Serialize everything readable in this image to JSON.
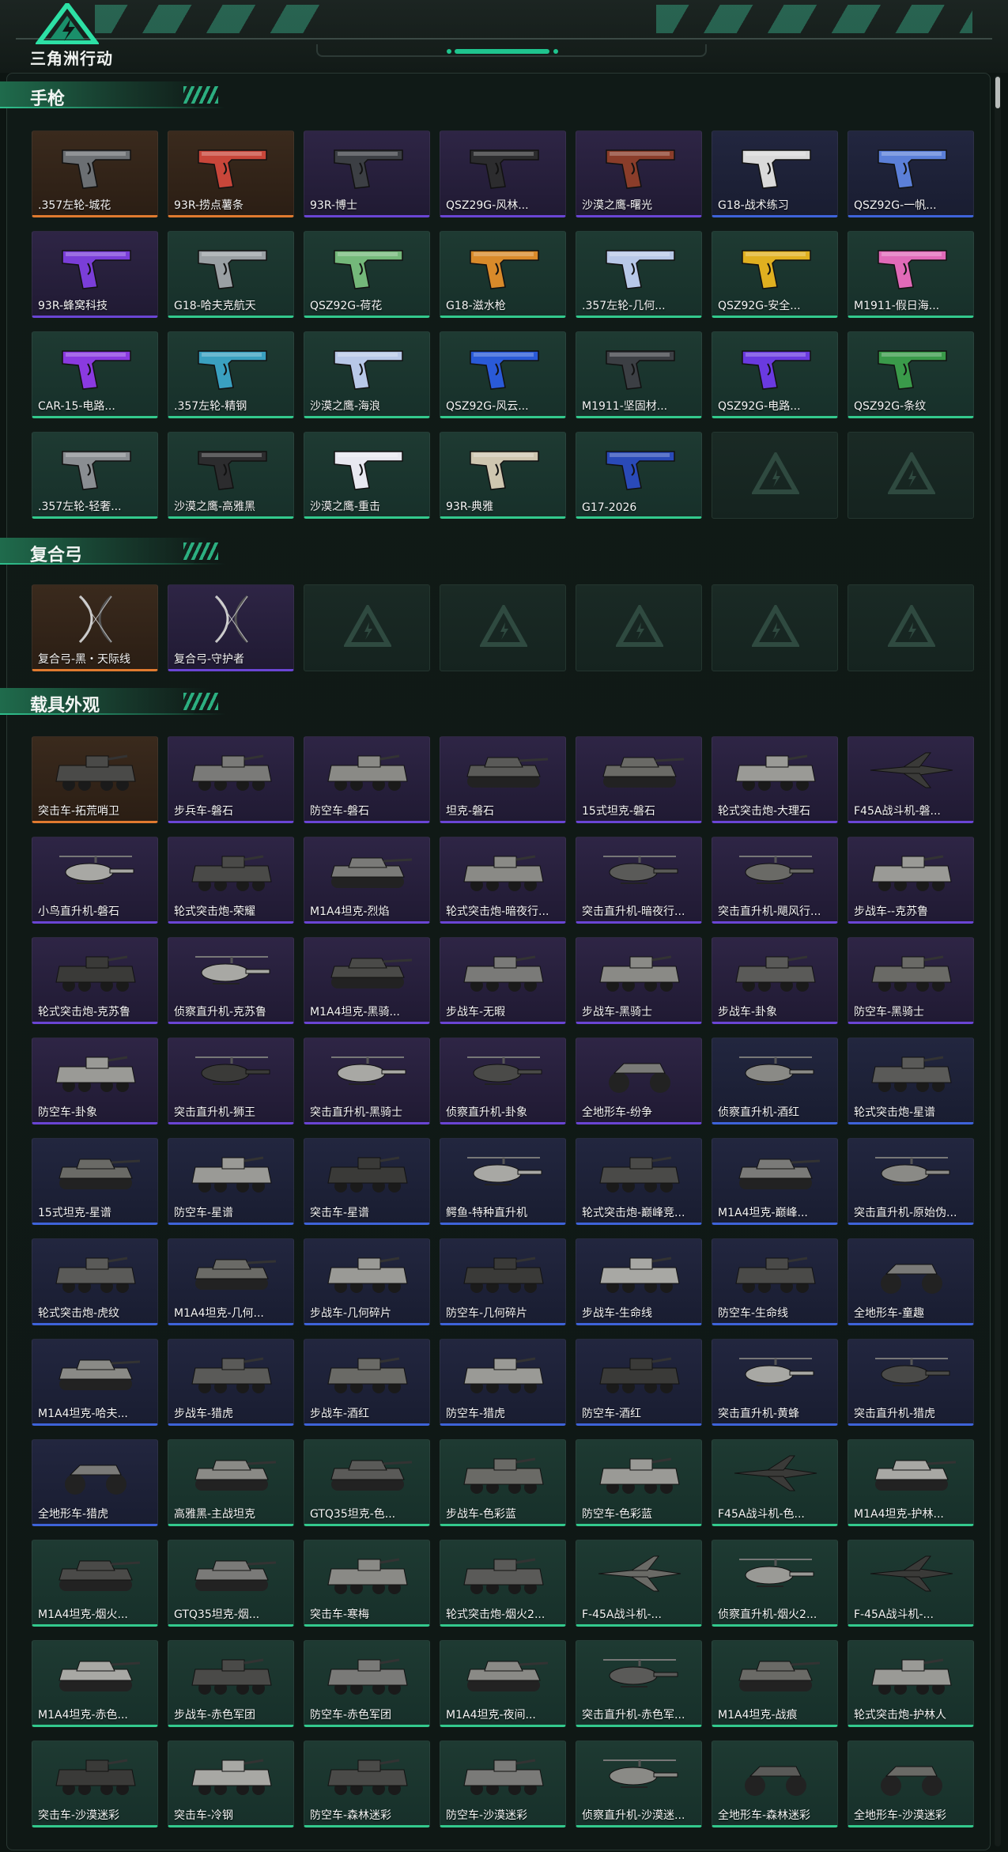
{
  "header": {
    "logo_text": "三角洲行动"
  },
  "sections": [
    {
      "title": "手枪",
      "kind": "pistol",
      "items": [
        {
          "name": ".357左轮-城花",
          "rarity": "orange"
        },
        {
          "name": "93R-捞点薯条",
          "rarity": "orange"
        },
        {
          "name": "93R-博士",
          "rarity": "purple"
        },
        {
          "name": "QSZ29G-风林...",
          "rarity": "purple"
        },
        {
          "name": "沙漠之鹰-曙光",
          "rarity": "purple"
        },
        {
          "name": "G18-战术练习",
          "rarity": "blue"
        },
        {
          "name": "QSZ92G-一帆...",
          "rarity": "blue"
        },
        {
          "name": "93R-蜂窝科技",
          "rarity": "purple"
        },
        {
          "name": "G18-哈夫克航天",
          "rarity": "green"
        },
        {
          "name": "QSZ92G-荷花",
          "rarity": "green"
        },
        {
          "name": "G18-滋水枪",
          "rarity": "green"
        },
        {
          "name": ".357左轮-几何...",
          "rarity": "green"
        },
        {
          "name": "QSZ92G-安全...",
          "rarity": "green"
        },
        {
          "name": "M1911-假日海...",
          "rarity": "green"
        },
        {
          "name": "CAR-15-电路...",
          "rarity": "green"
        },
        {
          "name": ".357左轮-精钢",
          "rarity": "green"
        },
        {
          "name": "沙漠之鹰-海浪",
          "rarity": "green"
        },
        {
          "name": "QSZ92G-风云...",
          "rarity": "green"
        },
        {
          "name": "M1911-坚固材...",
          "rarity": "green"
        },
        {
          "name": "QSZ92G-电路...",
          "rarity": "green"
        },
        {
          "name": "QSZ92G-条纹",
          "rarity": "green"
        },
        {
          "name": ".357左轮-轻奢...",
          "rarity": "green"
        },
        {
          "name": "沙漠之鹰-高雅黑",
          "rarity": "green"
        },
        {
          "name": "沙漠之鹰-重击",
          "rarity": "green"
        },
        {
          "name": "93R-典雅",
          "rarity": "green"
        },
        {
          "name": "G17-2026",
          "rarity": "green"
        },
        {
          "name": "",
          "rarity": "empty"
        },
        {
          "name": "",
          "rarity": "empty"
        }
      ]
    },
    {
      "title": "复合弓",
      "kind": "bow",
      "items": [
        {
          "name": "复合弓-黑・天际线",
          "rarity": "orange"
        },
        {
          "name": "复合弓-守护者",
          "rarity": "purple"
        },
        {
          "name": "",
          "rarity": "empty"
        },
        {
          "name": "",
          "rarity": "empty"
        },
        {
          "name": "",
          "rarity": "empty"
        },
        {
          "name": "",
          "rarity": "empty"
        },
        {
          "name": "",
          "rarity": "empty"
        }
      ]
    },
    {
      "title": "载具外观",
      "kind": "vehicle",
      "items": [
        {
          "name": "突击车-拓荒哨卫",
          "rarity": "orange"
        },
        {
          "name": "步兵车-磐石",
          "rarity": "purple"
        },
        {
          "name": "防空车-磐石",
          "rarity": "purple"
        },
        {
          "name": "坦克-磐石",
          "rarity": "purple"
        },
        {
          "name": "15式坦克-磐石",
          "rarity": "purple"
        },
        {
          "name": "轮式突击炮-大理石",
          "rarity": "purple"
        },
        {
          "name": "F45A战斗机-磐...",
          "rarity": "purple"
        },
        {
          "name": "小鸟直升机-磐石",
          "rarity": "purple"
        },
        {
          "name": "轮式突击炮-荣耀",
          "rarity": "purple"
        },
        {
          "name": "M1A4坦克-烈焰",
          "rarity": "purple"
        },
        {
          "name": "轮式突击炮-暗夜行...",
          "rarity": "purple"
        },
        {
          "name": "突击直升机-暗夜行...",
          "rarity": "purple"
        },
        {
          "name": "突击直升机-飓风行...",
          "rarity": "purple"
        },
        {
          "name": "步战车--克苏鲁",
          "rarity": "purple"
        },
        {
          "name": "轮式突击炮-克苏鲁",
          "rarity": "purple"
        },
        {
          "name": "侦察直升机-克苏鲁",
          "rarity": "purple"
        },
        {
          "name": "M1A4坦克-黑骑...",
          "rarity": "purple"
        },
        {
          "name": "步战车-无暇",
          "rarity": "purple"
        },
        {
          "name": "步战车-黑骑士",
          "rarity": "purple"
        },
        {
          "name": "步战车-卦象",
          "rarity": "purple"
        },
        {
          "name": "防空车-黑骑士",
          "rarity": "purple"
        },
        {
          "name": "防空车-卦象",
          "rarity": "purple"
        },
        {
          "name": "突击直升机-狮王",
          "rarity": "purple"
        },
        {
          "name": "突击直升机-黑骑士",
          "rarity": "purple"
        },
        {
          "name": "侦察直升机-卦象",
          "rarity": "purple"
        },
        {
          "name": "全地形车-纷争",
          "rarity": "purple"
        },
        {
          "name": "侦察直升机-酒红",
          "rarity": "blue"
        },
        {
          "name": "轮式突击炮-星谱",
          "rarity": "blue"
        },
        {
          "name": "15式坦克-星谱",
          "rarity": "blue"
        },
        {
          "name": "防空车-星谱",
          "rarity": "blue"
        },
        {
          "name": "突击车-星谱",
          "rarity": "blue"
        },
        {
          "name": "鳄鱼-特种直升机",
          "rarity": "blue"
        },
        {
          "name": "轮式突击炮-巅峰竞...",
          "rarity": "blue"
        },
        {
          "name": "M1A4坦克-巅峰...",
          "rarity": "blue"
        },
        {
          "name": "突击直升机-原始伪...",
          "rarity": "blue"
        },
        {
          "name": "轮式突击炮-虎纹",
          "rarity": "blue"
        },
        {
          "name": "M1A4坦克-几何...",
          "rarity": "blue"
        },
        {
          "name": "步战车-几何碎片",
          "rarity": "blue"
        },
        {
          "name": "防空车-几何碎片",
          "rarity": "blue"
        },
        {
          "name": "步战车-生命线",
          "rarity": "blue"
        },
        {
          "name": "防空车-生命线",
          "rarity": "blue"
        },
        {
          "name": "全地形车-童趣",
          "rarity": "blue"
        },
        {
          "name": "M1A4坦克-哈夫...",
          "rarity": "blue"
        },
        {
          "name": "步战车-猎虎",
          "rarity": "blue"
        },
        {
          "name": "步战车-酒红",
          "rarity": "blue"
        },
        {
          "name": "防空车-猎虎",
          "rarity": "blue"
        },
        {
          "name": "防空车-酒红",
          "rarity": "blue"
        },
        {
          "name": "突击直升机-黄蜂",
          "rarity": "blue"
        },
        {
          "name": "突击直升机-猎虎",
          "rarity": "blue"
        },
        {
          "name": "全地形车-猎虎",
          "rarity": "blue"
        },
        {
          "name": "高雅黑-主战坦克",
          "rarity": "green"
        },
        {
          "name": "GTQ35坦克-色...",
          "rarity": "green"
        },
        {
          "name": "步战车-色彩蓝",
          "rarity": "green"
        },
        {
          "name": "防空车-色彩蓝",
          "rarity": "green"
        },
        {
          "name": "F45A战斗机-色...",
          "rarity": "green"
        },
        {
          "name": "M1A4坦克-护林...",
          "rarity": "green"
        },
        {
          "name": "M1A4坦克-烟火...",
          "rarity": "green"
        },
        {
          "name": "GTQ35坦克-烟...",
          "rarity": "green"
        },
        {
          "name": "突击车-寒梅",
          "rarity": "green"
        },
        {
          "name": "轮式突击炮-烟火2...",
          "rarity": "green"
        },
        {
          "name": "F-45A战斗机-...",
          "rarity": "green"
        },
        {
          "name": "侦察直升机-烟火2...",
          "rarity": "green"
        },
        {
          "name": "F-45A战斗机-...",
          "rarity": "green"
        },
        {
          "name": "M1A4坦克-赤色...",
          "rarity": "green"
        },
        {
          "name": "步战车-赤色军团",
          "rarity": "green"
        },
        {
          "name": "防空车-赤色军团",
          "rarity": "green"
        },
        {
          "name": "M1A4坦克-夜间...",
          "rarity": "green"
        },
        {
          "name": "突击直升机-赤色军...",
          "rarity": "green"
        },
        {
          "name": "M1A4坦克-战痕",
          "rarity": "green"
        },
        {
          "name": "轮式突击炮-护林人",
          "rarity": "green"
        },
        {
          "name": "突击车-沙漠迷彩",
          "rarity": "green"
        },
        {
          "name": "突击车-冷钢",
          "rarity": "green"
        },
        {
          "name": "防空车-森林迷彩",
          "rarity": "green"
        },
        {
          "name": "防空车-沙漠迷彩",
          "rarity": "green"
        },
        {
          "name": "侦察直升机-沙漠迷...",
          "rarity": "green"
        },
        {
          "name": "全地形车-森林迷彩",
          "rarity": "green"
        },
        {
          "name": "全地形车-沙漠迷彩",
          "rarity": "green"
        }
      ]
    }
  ]
}
